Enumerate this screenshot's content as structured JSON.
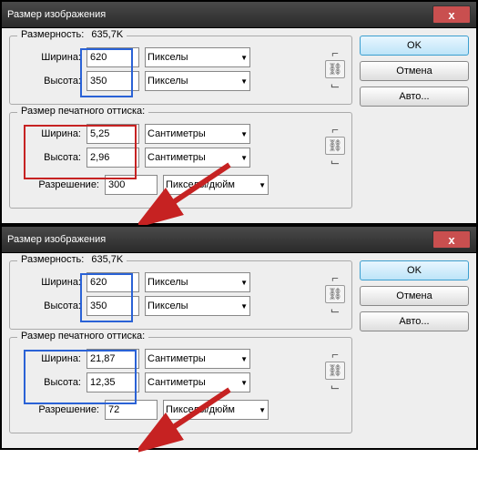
{
  "top": {
    "title": "Размер изображения",
    "dimensions_label": "Размерность:",
    "dimensions_value": "635,7K",
    "pixel_width_label": "Ширина:",
    "pixel_width_value": "620",
    "pixel_width_unit": "Пикселы",
    "pixel_height_label": "Высота:",
    "pixel_height_value": "350",
    "pixel_height_unit": "Пикселы",
    "print_group_label": "Размер печатного оттиска:",
    "print_width_label": "Ширина:",
    "print_width_value": "5,25",
    "print_width_unit": "Сантиметры",
    "print_height_label": "Высота:",
    "print_height_value": "2,96",
    "print_height_unit": "Сантиметры",
    "resolution_label": "Разрешение:",
    "resolution_value": "300",
    "resolution_unit": "Пикселы/дюйм",
    "ok": "OK",
    "cancel": "Отмена",
    "auto": "Авто..."
  },
  "bottom": {
    "title": "Размер изображения",
    "dimensions_label": "Размерность:",
    "dimensions_value": "635,7K",
    "pixel_width_label": "Ширина:",
    "pixel_width_value": "620",
    "pixel_width_unit": "Пикселы",
    "pixel_height_label": "Высота:",
    "pixel_height_value": "350",
    "pixel_height_unit": "Пикселы",
    "print_group_label": "Размер печатного оттиска:",
    "print_width_label": "Ширина:",
    "print_width_value": "21,87",
    "print_width_unit": "Сантиметры",
    "print_height_label": "Высота:",
    "print_height_value": "12,35",
    "print_height_unit": "Сантиметры",
    "resolution_label": "Разрешение:",
    "resolution_value": "72",
    "resolution_unit": "Пикселы/дюйм",
    "ok": "OK",
    "cancel": "Отмена",
    "auto": "Авто..."
  }
}
